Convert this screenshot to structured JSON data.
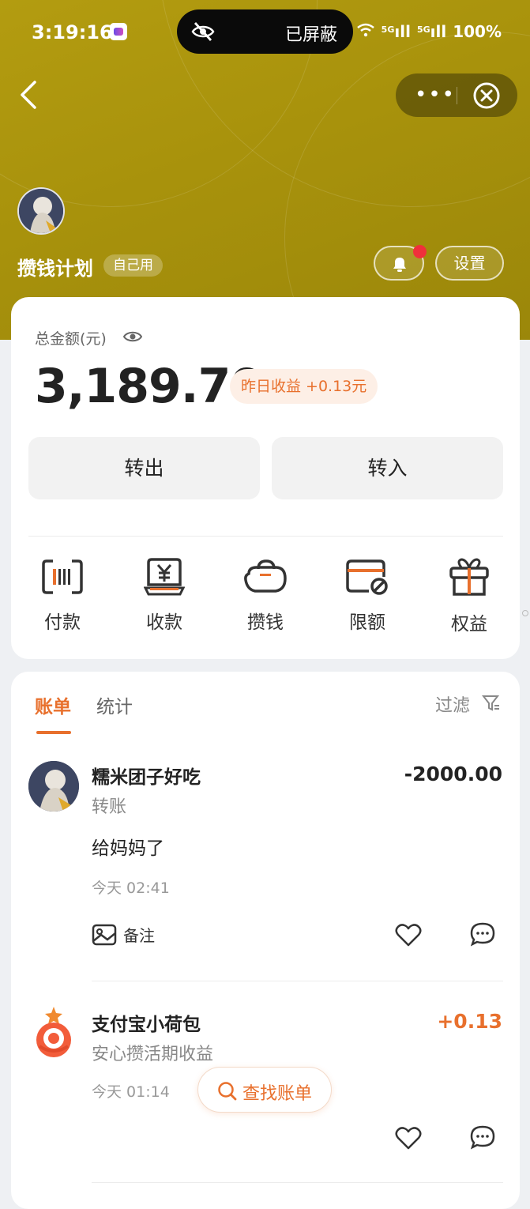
{
  "status_bar": {
    "time": "3:19:16",
    "privacy_text": "已屏蔽",
    "signal_1": "5G",
    "signal_2": "5G",
    "battery": "100%"
  },
  "header": {
    "plan_name": "攒钱计划",
    "plan_tag": "自己用",
    "settings_label": "设置"
  },
  "summary": {
    "total_label": "总金额(元)",
    "total_amount": "3,189.70",
    "yesterday_earnings": "昨日收益 +0.13元",
    "transfer_out_label": "转出",
    "transfer_in_label": "转入"
  },
  "quick_actions": [
    {
      "label": "付款",
      "icon": "barcode-icon"
    },
    {
      "label": "收款",
      "icon": "receive-yuan-icon"
    },
    {
      "label": "攒钱",
      "icon": "piggy-bank-icon"
    },
    {
      "label": "限额",
      "icon": "card-limit-icon"
    },
    {
      "label": "权益",
      "icon": "gift-icon"
    }
  ],
  "bills": {
    "tab_bill": "账单",
    "tab_stats": "统计",
    "filter_label": "过滤",
    "items": [
      {
        "name": "糯米团子好吃",
        "type": "转账",
        "note": "给妈妈了",
        "time": "今天 02:41",
        "amount": "-2000.00",
        "remark_label": "备注"
      },
      {
        "name": "支付宝小荷包",
        "type": "安心攒活期收益",
        "time": "今天 01:14",
        "amount": "+0.13"
      }
    ],
    "find_bill_label": "查找账单"
  },
  "colors": {
    "header_gold": "#a8920c",
    "accent_orange": "#e8702d",
    "red_badge": "#f0303b"
  }
}
